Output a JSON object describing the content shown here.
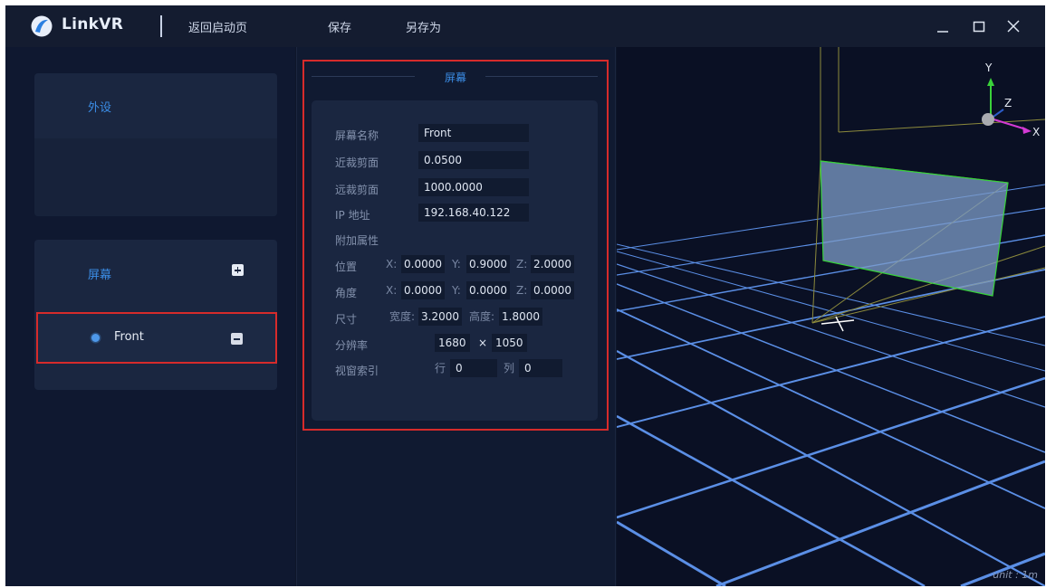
{
  "app": {
    "title": "LinkVR"
  },
  "menu": {
    "back": "返回启动页",
    "save": "保存",
    "save_as": "另存为"
  },
  "left": {
    "peripheral_label": "外设",
    "screens_label": "屏幕",
    "screen_items": [
      {
        "label": "Front",
        "selected": true
      }
    ]
  },
  "panel": {
    "title": "屏幕",
    "name_label": "屏幕名称",
    "name_value": "Front",
    "near_label": "近裁剪面",
    "near_value": "0.0500",
    "far_label": "远裁剪面",
    "far_value": "1000.0000",
    "ip_label": "IP 地址",
    "ip_value": "192.168.40.122",
    "extra_label": "附加属性",
    "position_label": "位置",
    "position": {
      "x": "0.0000",
      "y": "0.9000",
      "z": "2.0000"
    },
    "angle_label": "角度",
    "angle": {
      "x": "0.0000",
      "y": "0.0000",
      "z": "0.0000"
    },
    "size_label": "尺寸",
    "width_label": "宽度:",
    "width_value": "3.2000",
    "height_label": "高度:",
    "height_value": "1.8000",
    "resolution_label": "分辨率",
    "res_w": "1680",
    "res_x": "×",
    "res_h": "1050",
    "viewport_index_label": "视窗索引",
    "row_label": "行",
    "row_value": "0",
    "col_label": "列",
    "col_value": "0",
    "axis_x": "X:",
    "axis_y": "Y:",
    "axis_z": "Z:"
  },
  "viewport": {
    "gizmo": {
      "y": "Y",
      "z": "Z",
      "x": "X"
    },
    "unit": "unit : 1m"
  },
  "colors": {
    "accent": "#3b8de6",
    "highlight_border": "#d62b2b",
    "grid": "#5b8fe6",
    "screen_fill": "#7e9cc8",
    "screen_edge": "#37d33a",
    "frustum": "#8c8a3c"
  }
}
